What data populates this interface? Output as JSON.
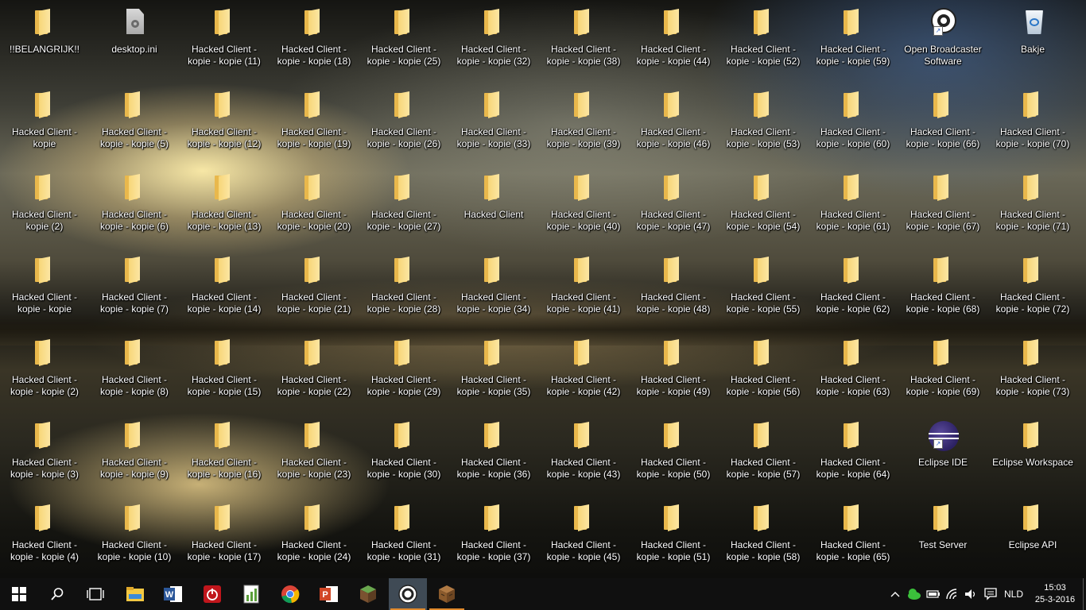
{
  "desktop": {
    "icons": [
      {
        "label": "!!BELANGRIJK!!",
        "type": "folder-icon"
      },
      {
        "label": "desktop.ini",
        "type": "settings-file-icon"
      },
      {
        "label": "Hacked Client - kopie - kopie (11)",
        "type": "folder-icon"
      },
      {
        "label": "Hacked Client - kopie - kopie (18)",
        "type": "folder-icon"
      },
      {
        "label": "Hacked Client - kopie - kopie (25)",
        "type": "folder-icon"
      },
      {
        "label": "Hacked Client - kopie - kopie (32)",
        "type": "folder-icon"
      },
      {
        "label": "Hacked Client - kopie - kopie (38)",
        "type": "folder-icon"
      },
      {
        "label": "Hacked Client - kopie - kopie (44)",
        "type": "folder-icon"
      },
      {
        "label": "Hacked Client - kopie - kopie (52)",
        "type": "folder-icon"
      },
      {
        "label": "Hacked Client - kopie - kopie (59)",
        "type": "folder-icon"
      },
      {
        "label": "Open Broadcaster Software",
        "type": "obs-icon"
      },
      {
        "label": "Bakje",
        "type": "recycle-bin-icon"
      },
      {
        "label": "Hacked Client - kopie",
        "type": "folder-icon"
      },
      {
        "label": "Hacked Client - kopie - kopie (5)",
        "type": "folder-icon"
      },
      {
        "label": "Hacked Client - kopie - kopie (12)",
        "type": "folder-icon"
      },
      {
        "label": "Hacked Client - kopie - kopie (19)",
        "type": "folder-icon"
      },
      {
        "label": "Hacked Client - kopie - kopie (26)",
        "type": "folder-icon"
      },
      {
        "label": "Hacked Client - kopie - kopie (33)",
        "type": "folder-icon"
      },
      {
        "label": "Hacked Client - kopie - kopie (39)",
        "type": "folder-icon"
      },
      {
        "label": "Hacked Client - kopie - kopie (46)",
        "type": "folder-icon"
      },
      {
        "label": "Hacked Client - kopie - kopie (53)",
        "type": "folder-icon"
      },
      {
        "label": "Hacked Client - kopie - kopie (60)",
        "type": "folder-icon"
      },
      {
        "label": "Hacked Client - kopie - kopie (66)",
        "type": "folder-icon"
      },
      {
        "label": "Hacked Client - kopie - kopie (70)",
        "type": "folder-icon"
      },
      {
        "label": "Hacked Client - kopie (2)",
        "type": "folder-icon"
      },
      {
        "label": "Hacked Client - kopie - kopie (6)",
        "type": "folder-icon"
      },
      {
        "label": "Hacked Client - kopie - kopie (13)",
        "type": "folder-icon"
      },
      {
        "label": "Hacked Client - kopie - kopie (20)",
        "type": "folder-icon"
      },
      {
        "label": "Hacked Client - kopie - kopie (27)",
        "type": "folder-icon"
      },
      {
        "label": "Hacked Client",
        "type": "folder-icon"
      },
      {
        "label": "Hacked Client - kopie - kopie (40)",
        "type": "folder-icon"
      },
      {
        "label": "Hacked Client - kopie - kopie (47)",
        "type": "folder-icon"
      },
      {
        "label": "Hacked Client - kopie - kopie (54)",
        "type": "folder-icon"
      },
      {
        "label": "Hacked Client - kopie - kopie (61)",
        "type": "folder-icon"
      },
      {
        "label": "Hacked Client - kopie - kopie (67)",
        "type": "folder-icon"
      },
      {
        "label": "Hacked Client - kopie - kopie (71)",
        "type": "folder-icon"
      },
      {
        "label": "Hacked Client - kopie - kopie",
        "type": "folder-icon"
      },
      {
        "label": "Hacked Client - kopie - kopie (7)",
        "type": "folder-icon"
      },
      {
        "label": "Hacked Client - kopie - kopie (14)",
        "type": "folder-icon"
      },
      {
        "label": "Hacked Client - kopie - kopie (21)",
        "type": "folder-icon"
      },
      {
        "label": "Hacked Client - kopie - kopie (28)",
        "type": "folder-icon"
      },
      {
        "label": "Hacked Client - kopie - kopie (34)",
        "type": "folder-icon"
      },
      {
        "label": "Hacked Client - kopie - kopie (41)",
        "type": "folder-icon"
      },
      {
        "label": "Hacked Client - kopie - kopie (48)",
        "type": "folder-icon"
      },
      {
        "label": "Hacked Client - kopie - kopie (55)",
        "type": "folder-icon"
      },
      {
        "label": "Hacked Client - kopie - kopie (62)",
        "type": "folder-icon"
      },
      {
        "label": "Hacked Client - kopie - kopie (68)",
        "type": "folder-icon"
      },
      {
        "label": "Hacked Client - kopie - kopie (72)",
        "type": "folder-icon"
      },
      {
        "label": "Hacked Client - kopie - kopie (2)",
        "type": "folder-icon"
      },
      {
        "label": "Hacked Client - kopie - kopie (8)",
        "type": "folder-icon"
      },
      {
        "label": "Hacked Client - kopie - kopie (15)",
        "type": "folder-icon"
      },
      {
        "label": "Hacked Client - kopie - kopie (22)",
        "type": "folder-icon"
      },
      {
        "label": "Hacked Client - kopie - kopie (29)",
        "type": "folder-icon"
      },
      {
        "label": "Hacked Client - kopie - kopie (35)",
        "type": "folder-icon"
      },
      {
        "label": "Hacked Client - kopie - kopie (42)",
        "type": "folder-icon"
      },
      {
        "label": "Hacked Client - kopie - kopie (49)",
        "type": "folder-icon"
      },
      {
        "label": "Hacked Client - kopie - kopie (56)",
        "type": "folder-icon"
      },
      {
        "label": "Hacked Client - kopie - kopie (63)",
        "type": "folder-icon"
      },
      {
        "label": "Hacked Client - kopie - kopie (69)",
        "type": "folder-icon"
      },
      {
        "label": "Hacked Client - kopie - kopie (73)",
        "type": "folder-icon"
      },
      {
        "label": "Hacked Client - kopie - kopie (3)",
        "type": "folder-icon"
      },
      {
        "label": "Hacked Client - kopie - kopie (9)",
        "type": "folder-icon"
      },
      {
        "label": "Hacked Client - kopie - kopie (16)",
        "type": "folder-icon"
      },
      {
        "label": "Hacked Client - kopie - kopie (23)",
        "type": "folder-icon"
      },
      {
        "label": "Hacked Client - kopie - kopie (30)",
        "type": "folder-icon"
      },
      {
        "label": "Hacked Client - kopie - kopie (36)",
        "type": "folder-icon"
      },
      {
        "label": "Hacked Client - kopie - kopie (43)",
        "type": "folder-icon"
      },
      {
        "label": "Hacked Client - kopie - kopie (50)",
        "type": "folder-icon"
      },
      {
        "label": "Hacked Client - kopie - kopie (57)",
        "type": "folder-icon"
      },
      {
        "label": "Hacked Client - kopie - kopie (64)",
        "type": "folder-icon"
      },
      {
        "label": "Eclipse IDE",
        "type": "eclipse-icon"
      },
      {
        "label": "Eclipse Workspace",
        "type": "folder-icon"
      },
      {
        "label": "Hacked Client - kopie - kopie (4)",
        "type": "folder-icon"
      },
      {
        "label": "Hacked Client - kopie - kopie (10)",
        "type": "folder-icon"
      },
      {
        "label": "Hacked Client - kopie - kopie (17)",
        "type": "folder-icon"
      },
      {
        "label": "Hacked Client - kopie - kopie (24)",
        "type": "folder-icon"
      },
      {
        "label": "Hacked Client - kopie - kopie (31)",
        "type": "folder-icon"
      },
      {
        "label": "Hacked Client - kopie - kopie (37)",
        "type": "folder-icon"
      },
      {
        "label": "Hacked Client - kopie - kopie (45)",
        "type": "folder-icon"
      },
      {
        "label": "Hacked Client - kopie - kopie (51)",
        "type": "folder-icon"
      },
      {
        "label": "Hacked Client - kopie - kopie (58)",
        "type": "folder-icon"
      },
      {
        "label": "Hacked Client - kopie - kopie (65)",
        "type": "folder-icon"
      },
      {
        "label": "Test Server",
        "type": "folder-icon"
      },
      {
        "label": "Eclipse API",
        "type": "folder-icon"
      }
    ]
  },
  "taskbar": {
    "pinned": [
      {
        "name": "start-button",
        "icon": "windows-logo-icon",
        "color": "#ffffff"
      },
      {
        "name": "search-button",
        "icon": "search-icon",
        "color": "#ffffff"
      },
      {
        "name": "task-view-button",
        "icon": "task-view-icon",
        "color": "#ffffff"
      },
      {
        "name": "file-explorer-button",
        "icon": "file-explorer-icon",
        "color": "#f3c842"
      },
      {
        "name": "word-button",
        "icon": "word-icon",
        "color": "#2b579a"
      },
      {
        "name": "power-app-button",
        "icon": "power-icon",
        "color": "#c0161c"
      },
      {
        "name": "chart-app-button",
        "icon": "chart-icon",
        "color": "#5a9e3a"
      },
      {
        "name": "chrome-button",
        "icon": "chrome-icon",
        "color": "#4285f4"
      },
      {
        "name": "powerpoint-button",
        "icon": "powerpoint-icon",
        "color": "#d24726"
      },
      {
        "name": "minecraft-button",
        "icon": "minecraft-grass-icon",
        "color": "#5b8c32"
      },
      {
        "name": "obs-taskbar-button",
        "icon": "obs-icon",
        "color": "#ffffff"
      },
      {
        "name": "minecraft-launcher-button",
        "icon": "crafting-table-icon",
        "color": "#9b6b3a"
      }
    ],
    "tray": {
      "language": "NLD",
      "time": "15:03",
      "date": "25-3-2016"
    }
  }
}
